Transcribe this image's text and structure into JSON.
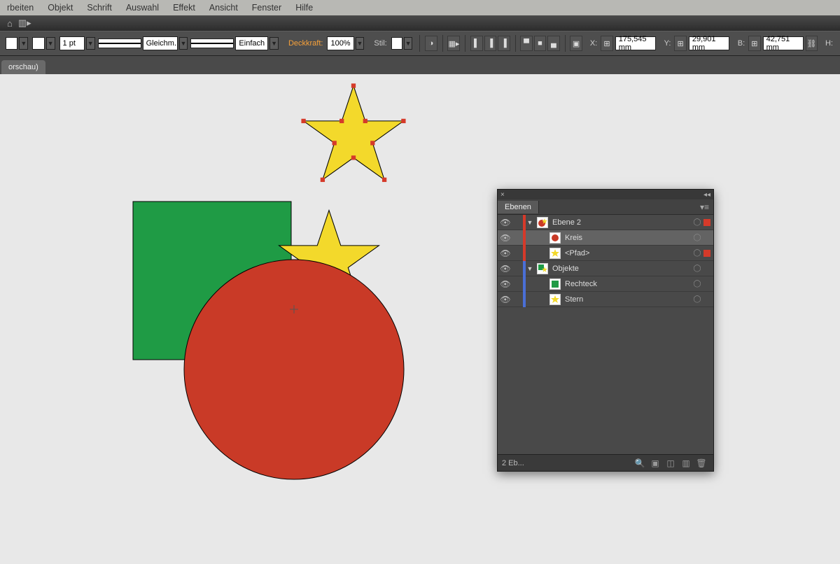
{
  "menu": {
    "items": [
      "rbeiten",
      "Objekt",
      "Schrift",
      "Auswahl",
      "Effekt",
      "Ansicht",
      "Fenster",
      "Hilfe"
    ]
  },
  "options": {
    "stroke_weight": "1 pt",
    "brush_label": "Gleichm.",
    "profile_label": "Einfach",
    "opacity_label": "Deckkraft:",
    "opacity_value": "100%",
    "style_label": "Stil:",
    "x_label": "X:",
    "x_value": "175,545 mm",
    "y_label": "Y:",
    "y_value": "29,901 mm",
    "w_label": "B:",
    "w_value": "42,751 mm",
    "h_label": "H:"
  },
  "tab": {
    "label": "orschau)"
  },
  "panel": {
    "title": "Ebenen",
    "rows": [
      {
        "name": "Ebene 2",
        "indent": 0,
        "twisty": true,
        "stripe": "#d53a2a",
        "selected": false,
        "selind": "#d53a2a",
        "thumb": "ebene2"
      },
      {
        "name": "Kreis",
        "indent": 1,
        "twisty": false,
        "stripe": "#d53a2a",
        "selected": true,
        "selind": "",
        "thumb": "circle"
      },
      {
        "name": "<Pfad>",
        "indent": 1,
        "twisty": false,
        "stripe": "#d53a2a",
        "selected": false,
        "selind": "#d53a2a",
        "thumb": "star"
      },
      {
        "name": "Objekte",
        "indent": 0,
        "twisty": true,
        "stripe": "#4a6fd6",
        "selected": false,
        "selind": "",
        "thumb": "objekte"
      },
      {
        "name": "Rechteck",
        "indent": 1,
        "twisty": false,
        "stripe": "#4a6fd6",
        "selected": false,
        "selind": "",
        "thumb": "square"
      },
      {
        "name": "Stern",
        "indent": 1,
        "twisty": false,
        "stripe": "#4a6fd6",
        "selected": false,
        "selind": "",
        "thumb": "star"
      }
    ],
    "footer_status": "2 Eb..."
  },
  "colors": {
    "green": "#1f9b45",
    "red": "#c93a27",
    "yellow": "#f3d92b"
  }
}
